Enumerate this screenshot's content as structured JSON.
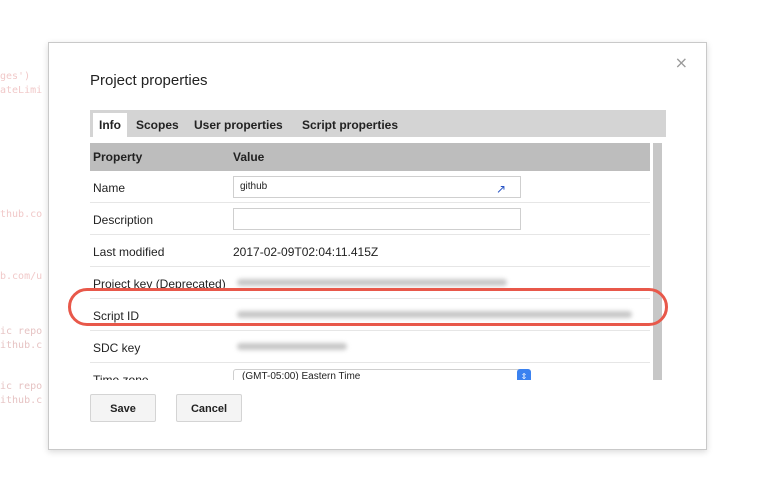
{
  "background_code": [
    "ges')",
    "ateLimi",
    "thub.co",
    "b.com/u",
    "ic repo",
    "ithub.c",
    "ic repo",
    "ithub.c"
  ],
  "dialog": {
    "title": "Project properties",
    "close_label": "×",
    "tabs": [
      "Info",
      "Scopes",
      "User properties",
      "Script properties"
    ],
    "active_tab": "Info",
    "table": {
      "columns": [
        "Property",
        "Value"
      ],
      "rows": [
        {
          "key": "Name",
          "value": "github",
          "kind": "input-edit"
        },
        {
          "key": "Description",
          "value": "",
          "kind": "input"
        },
        {
          "key": "Last modified",
          "value": "2017-02-09T02:04:11.415Z",
          "kind": "text"
        },
        {
          "key": "Project key (Deprecated)",
          "value": "",
          "kind": "redacted"
        },
        {
          "key": "Script ID",
          "value": "",
          "kind": "redacted"
        },
        {
          "key": "SDC key",
          "value": "",
          "kind": "redacted"
        },
        {
          "key": "Time zone",
          "value": "(GMT-05:00) Eastern Time",
          "kind": "select"
        }
      ]
    },
    "buttons": {
      "save": "Save",
      "cancel": "Cancel"
    }
  },
  "colors": {
    "highlight": "#e8584a",
    "select_accent": "#3b82f0",
    "header_bg": "#bdbdbd"
  }
}
